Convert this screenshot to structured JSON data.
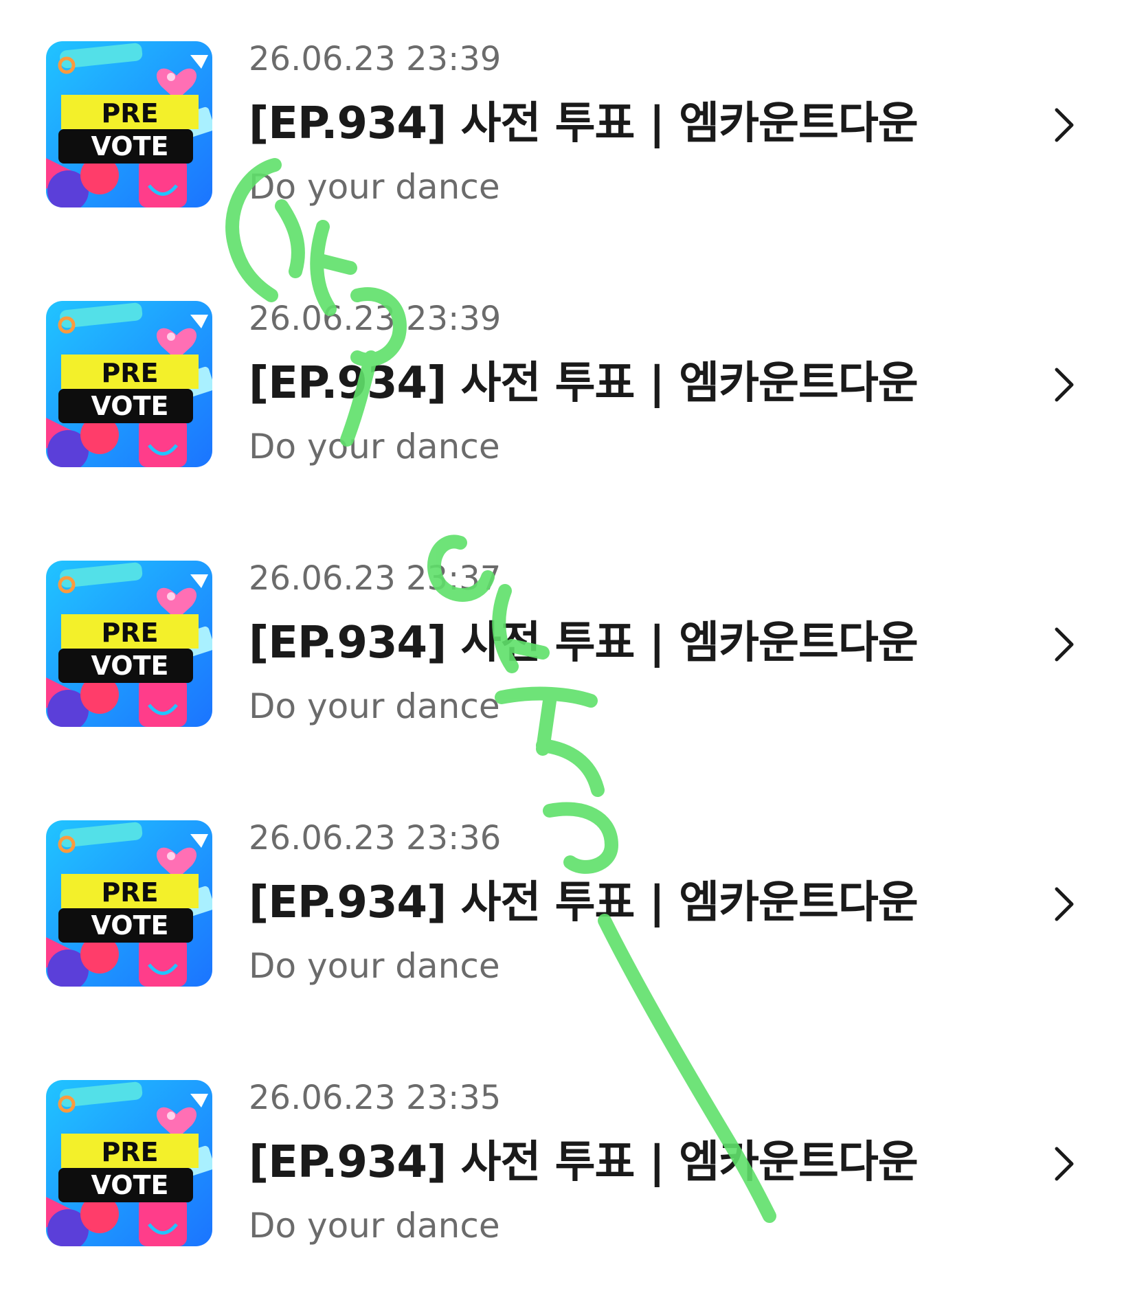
{
  "items": [
    {
      "date": "26.06.23 23:39",
      "title": "[EP.934] 사전 투표 | 엠카운트다운",
      "subtitle": "Do your dance",
      "thumb_text": [
        "PRE",
        "VOTE"
      ]
    },
    {
      "date": "26.06.23 23:39",
      "title": "[EP.934] 사전 투표 | 엠카운트다운",
      "subtitle": "Do your dance",
      "thumb_text": [
        "PRE",
        "VOTE"
      ]
    },
    {
      "date": "26.06.23 23:37",
      "title": "[EP.934] 사전 투표 | 엠카운트다운",
      "subtitle": "Do your dance",
      "thumb_text": [
        "PRE",
        "VOTE"
      ]
    },
    {
      "date": "26.06.23 23:36",
      "title": "[EP.934] 사전 투표 | 엠카운트다운",
      "subtitle": "Do your dance",
      "thumb_text": [
        "PRE",
        "VOTE"
      ]
    },
    {
      "date": "26.06.23 23:35",
      "title": "[EP.934] 사전 투표 | 엠카운트다운",
      "subtitle": "Do your dance",
      "thumb_text": [
        "PRE",
        "VOTE"
      ]
    }
  ],
  "icons": {
    "row_action": "chevron-right-icon",
    "thumbnail": "pre-vote-thumbnail"
  },
  "colors": {
    "text_primary": "#1a1a1a",
    "text_secondary": "#6b6b6b",
    "scribble": "#5fe06a",
    "thumb_yellow": "#f3f02a",
    "thumb_black": "#0d0d0d",
    "thumb_blue": "#2f8cff",
    "thumb_pink": "#ff3d8a"
  }
}
